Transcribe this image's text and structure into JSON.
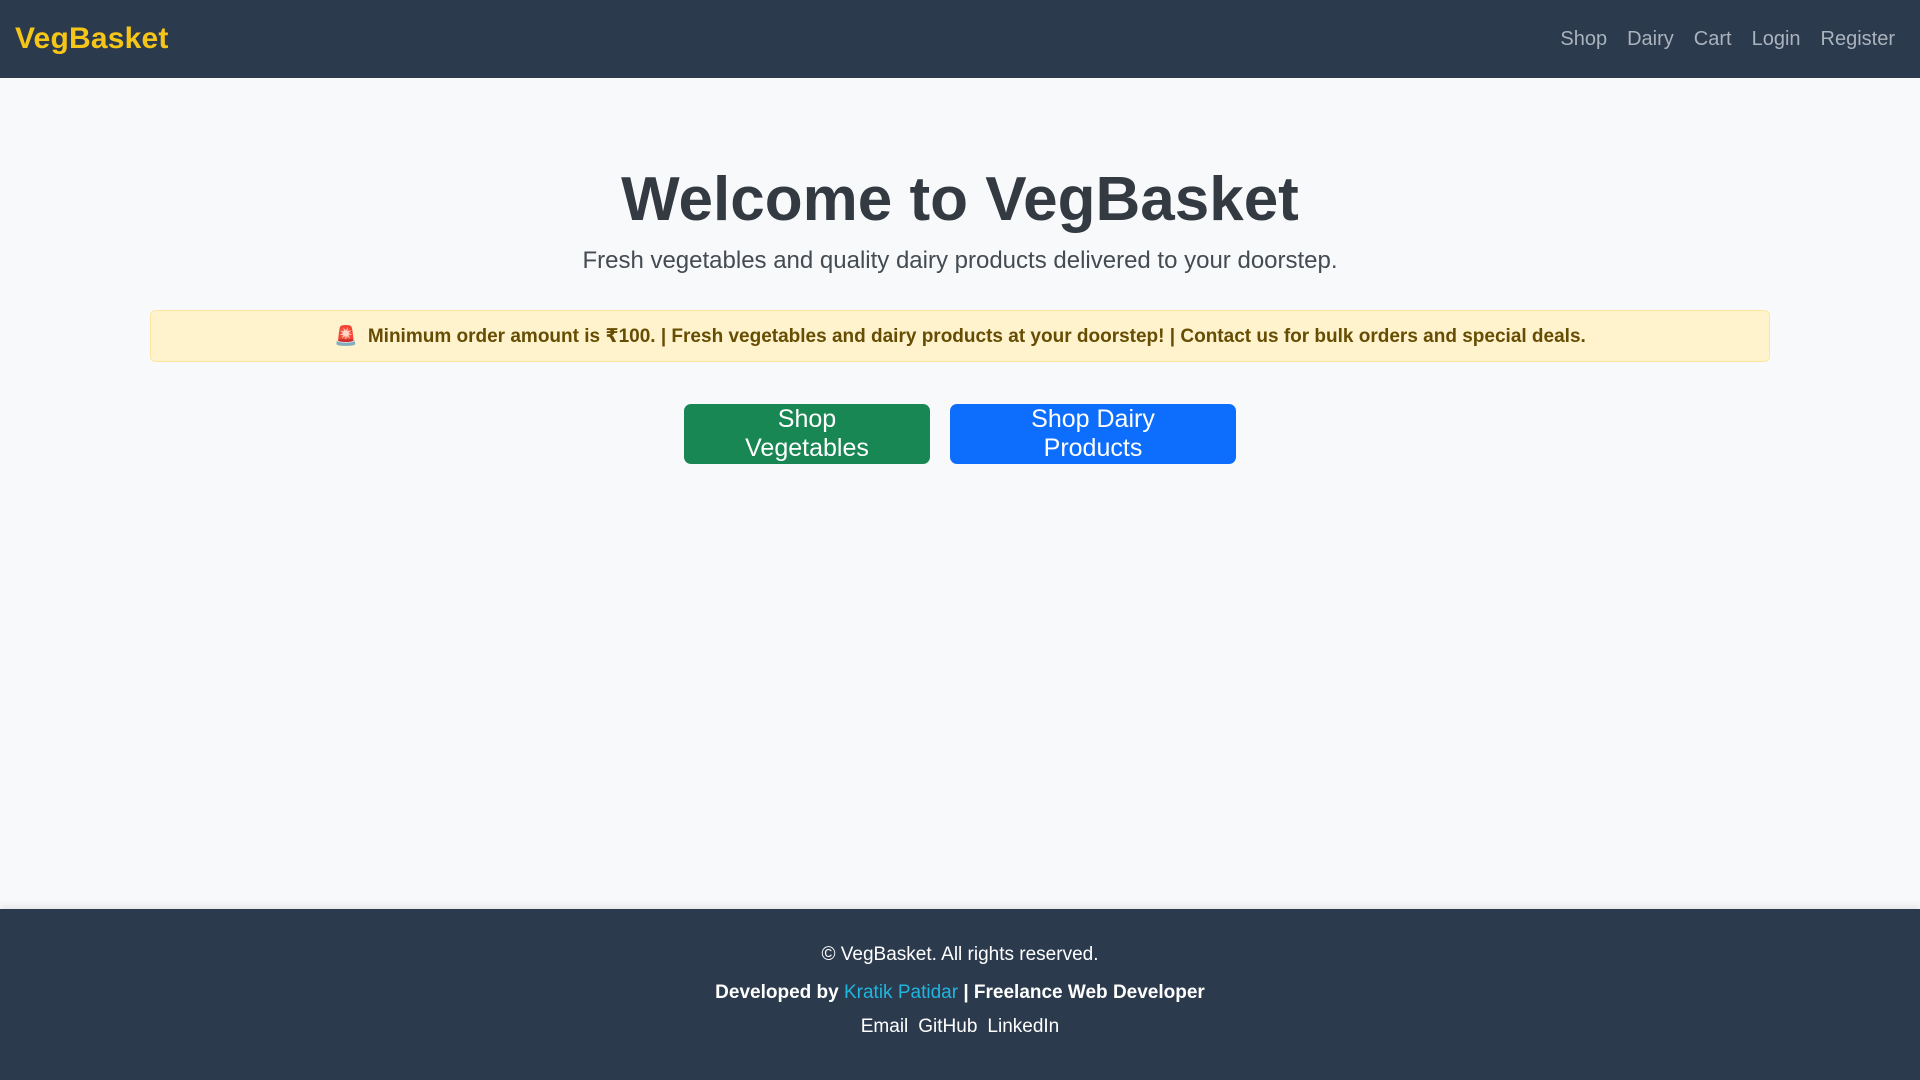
{
  "navbar": {
    "brand": "VegBasket",
    "links": [
      "Shop",
      "Dairy",
      "Cart",
      "Login",
      "Register"
    ]
  },
  "hero": {
    "title": "Welcome to VegBasket",
    "subtitle": "Fresh vegetables and quality dairy products delivered to your doorstep."
  },
  "alert": {
    "icon": "siren-icon",
    "icon_glyph": "🚨",
    "text": "Minimum order amount is ₹100. | Fresh vegetables and dairy products at your doorstep! | Contact us for bulk orders and special deals."
  },
  "buttons": {
    "vegetables": "Shop Vegetables",
    "dairy": "Shop Dairy Products"
  },
  "footer": {
    "copyright": "© VegBasket. All rights reserved.",
    "developed_by": "Developed by",
    "developer_name": "Kratik Patidar",
    "developer_role": "| Freelance Web Developer",
    "social_links": [
      "Email",
      "GitHub",
      "LinkedIn"
    ]
  },
  "colors": {
    "navbar_bg": "#2c3a4d",
    "brand": "#f5c518",
    "veg_button": "#198754",
    "dairy_button": "#0d6efd",
    "alert_bg": "#fff3cd",
    "developer_link": "#1fb6e0"
  }
}
